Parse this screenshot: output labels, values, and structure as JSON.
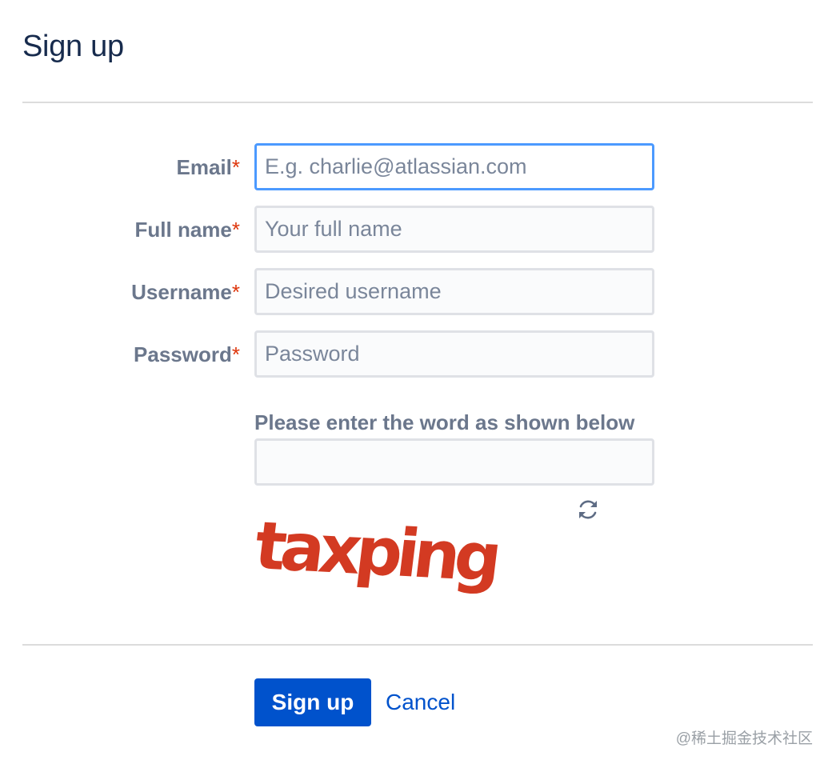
{
  "page": {
    "title": "Sign up"
  },
  "form": {
    "email": {
      "label": "Email",
      "required_mark": "*",
      "placeholder": "E.g. charlie@atlassian.com",
      "value": ""
    },
    "full_name": {
      "label": "Full name",
      "required_mark": "*",
      "placeholder": "Your full name",
      "value": ""
    },
    "username": {
      "label": "Username",
      "required_mark": "*",
      "placeholder": "Desired username",
      "value": ""
    },
    "password": {
      "label": "Password",
      "required_mark": "*",
      "placeholder": "Password",
      "value": ""
    },
    "captcha": {
      "label": "Please enter the word as shown below",
      "value": "",
      "word": "taxping",
      "refresh_icon": "refresh-icon"
    }
  },
  "actions": {
    "submit_label": "Sign up",
    "cancel_label": "Cancel"
  },
  "watermark": "@稀土掘金技术社区",
  "colors": {
    "primary": "#0052cc",
    "required": "#de350b",
    "focus_border": "#4c9aff",
    "captcha_text": "#d33a22"
  }
}
